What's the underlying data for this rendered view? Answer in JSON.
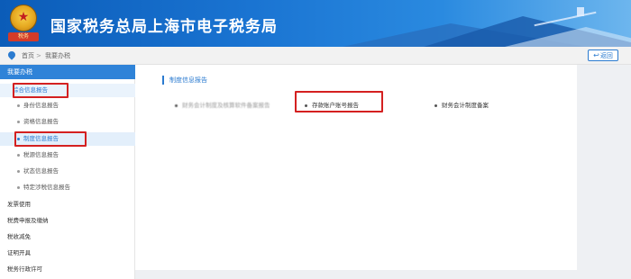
{
  "header": {
    "site_title": "国家税务总局上海市电子税务局",
    "emblem_text": "税务"
  },
  "breadcrumb": {
    "home": "首页",
    "separator": ">",
    "current": "我要办税"
  },
  "back_button": {
    "label": "返回"
  },
  "sidebar": {
    "heading": "我要办税",
    "group_label": "综合信息报告",
    "sub_items": [
      "身份信息报告",
      "资格信息报告",
      "制度信息报告",
      "税源信息报告",
      "状态信息报告",
      "特定涉税信息报告"
    ],
    "top_items": [
      "发票使用",
      "税费申报及缴纳",
      "税收减免",
      "证明开具",
      "税务行政许可"
    ]
  },
  "main": {
    "section_title": "制度信息报告",
    "links": [
      "财务会计制度及核算软件备案报告",
      "存款账户账号报告",
      "财务会计制度备案"
    ]
  },
  "colors": {
    "accent": "#2b7bd0",
    "highlight_box": "#d42020",
    "banner": "#1a74d2"
  }
}
